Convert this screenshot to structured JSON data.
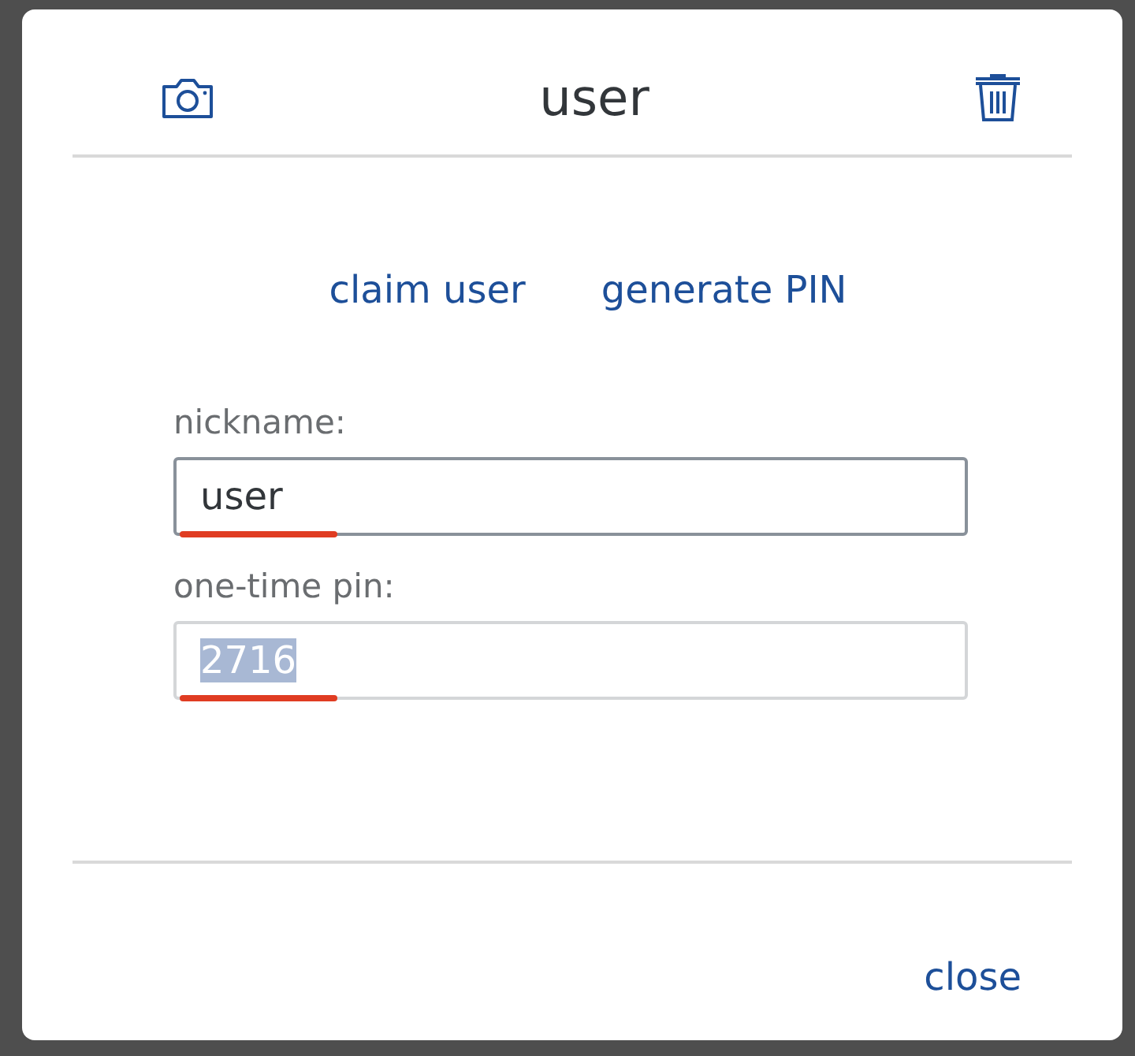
{
  "dialog": {
    "title": "user"
  },
  "actions": [
    "claim user",
    "generate PIN"
  ],
  "fields": [
    {
      "label": "nickname:",
      "value": "user",
      "focused": true,
      "value_selected": false,
      "underlined": true
    },
    {
      "label": "one-time pin:",
      "value": "2716",
      "focused": false,
      "value_selected": true,
      "underlined": true
    }
  ],
  "footer": {
    "button": "close"
  }
}
